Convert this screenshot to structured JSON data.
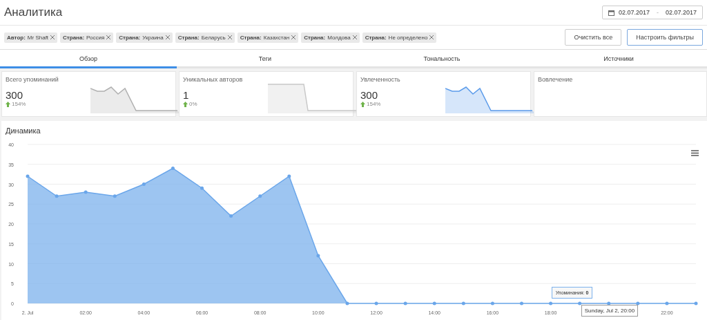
{
  "header": {
    "title": "Аналитика",
    "date_from": "02.07.2017",
    "date_separator": "-",
    "date_to": "02.07.2017"
  },
  "filters": [
    {
      "key": "Автор:",
      "value": "Mr Shaft"
    },
    {
      "key": "Страна:",
      "value": "Россия"
    },
    {
      "key": "Страна:",
      "value": "Украина"
    },
    {
      "key": "Страна:",
      "value": "Беларусь"
    },
    {
      "key": "Страна:",
      "value": "Казахстан"
    },
    {
      "key": "Страна:",
      "value": "Молдова"
    },
    {
      "key": "Страна:",
      "value": "Не определено"
    }
  ],
  "buttons": [
    {
      "label": "Очистить все",
      "primary": false
    },
    {
      "label": "Настроить фильтры",
      "primary": true
    }
  ],
  "tabs": [
    {
      "label": "Обзор",
      "selected": true
    },
    {
      "label": "Теги",
      "selected": false
    },
    {
      "label": "Тональность",
      "selected": false
    },
    {
      "label": "Источники",
      "selected": false
    }
  ],
  "cards": [
    {
      "title": "Всего упоминаний",
      "value": "300",
      "delta": "154%",
      "kind": "wave",
      "color": "#b0b0b0"
    },
    {
      "title": "Уникальных авторов",
      "value": "1",
      "delta": "0%",
      "kind": "step",
      "color": "#c8c8c8"
    },
    {
      "title": "Увлеченность",
      "value": "300",
      "delta": "154%",
      "kind": "wave",
      "color": "#5b9bea"
    },
    {
      "title": "Вовлечение"
    }
  ],
  "dynamics": {
    "title": "Динамика",
    "chart_data": {
      "type": "area",
      "grid": true,
      "x": [
        0,
        1,
        2,
        3,
        4,
        5,
        6,
        7,
        8,
        9,
        10,
        11,
        12,
        13,
        14,
        15,
        16,
        17,
        18,
        19,
        20,
        21,
        22,
        23
      ],
      "series": [
        {
          "color": "#7cb1ec",
          "values": [
            32,
            27,
            28,
            27,
            30,
            34,
            29,
            22,
            27,
            32,
            12,
            0,
            0,
            0,
            0,
            0,
            0,
            0,
            0,
            0,
            0,
            0,
            0,
            0
          ]
        }
      ],
      "xlim": [
        0,
        23
      ],
      "ylim": [
        0,
        40
      ],
      "yticks": [
        0,
        5,
        10,
        15,
        20,
        25,
        30,
        35,
        40
      ],
      "xticks": [
        {
          "value": 0,
          "label": "2. Jul"
        },
        {
          "value": 2,
          "label": "02:00"
        },
        {
          "value": 4,
          "label": "04:00"
        },
        {
          "value": 6,
          "label": "06:00"
        },
        {
          "value": 8,
          "label": "08:00"
        },
        {
          "value": 10,
          "label": "10:00"
        },
        {
          "value": 12,
          "label": "12:00"
        },
        {
          "value": 14,
          "label": "14:00"
        },
        {
          "value": 16,
          "label": "16:00"
        },
        {
          "value": 18,
          "label": "18:00"
        },
        {
          "value": 22,
          "label": "22:00"
        }
      ]
    },
    "tooltip": {
      "label": "Упоминания:",
      "value": "0",
      "header": "Sunday, Jul 2, 20:00"
    }
  }
}
